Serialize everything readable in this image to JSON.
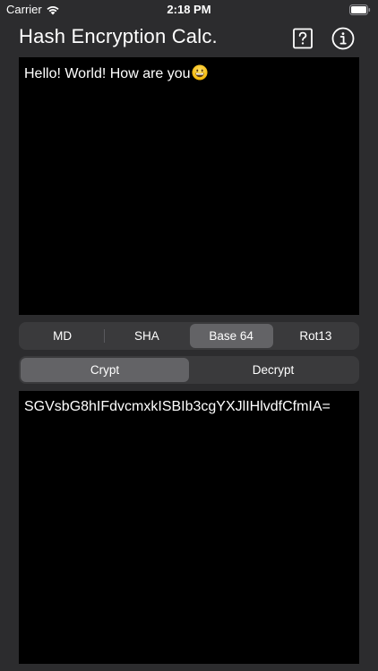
{
  "status_bar": {
    "carrier": "Carrier",
    "time": "2:18 PM"
  },
  "nav": {
    "title": "Hash Encryption Calc.",
    "help_icon": "question-mark-square-icon",
    "info_icon": "info-circle-icon"
  },
  "input": {
    "text": "Hello! World! How are you",
    "emoji": "grinning-face-emoji"
  },
  "algorithms": {
    "items": [
      "MD",
      "SHA",
      "Base 64",
      "Rot13"
    ],
    "selected": "Base 64"
  },
  "mode": {
    "items": [
      "Crypt",
      "Decrypt"
    ],
    "selected": "Crypt"
  },
  "output": {
    "text": "SGVsbG8hIFdvcmxkISBIb3cgYXJlIHlvdfCfmIA="
  },
  "colors": {
    "background": "#2c2c2e",
    "panel": "#000000",
    "segment_bg": "#3a3a3c",
    "segment_selected": "#636366"
  }
}
